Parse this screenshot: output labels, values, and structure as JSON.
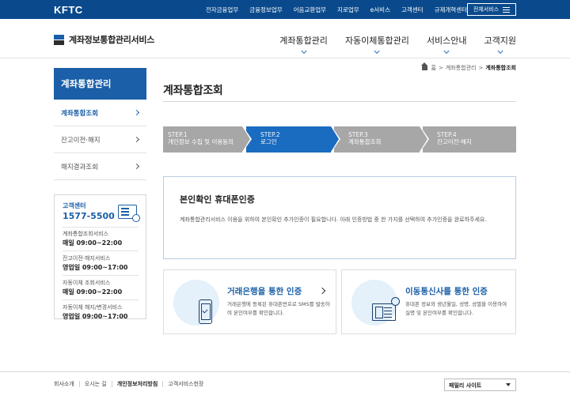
{
  "topbar": {
    "logo": "KFTC",
    "links": [
      "전자금융업무",
      "금융정보업무",
      "어음교환업무",
      "지로업무",
      "e서비스",
      "고객센터",
      "규제개혁센터"
    ],
    "all_services": "전체서비스"
  },
  "header": {
    "brand": "계좌정보통합관리서비스",
    "nav": [
      "계좌통합관리",
      "자동이체통합관리",
      "서비스안내",
      "고객지원"
    ]
  },
  "breadcrumb": {
    "items": [
      "홈",
      "계좌통합관리",
      "계좌통합조회"
    ]
  },
  "sidebar": {
    "title": "계좌통합관리",
    "items": [
      {
        "label": "계좌통합조회",
        "active": true
      },
      {
        "label": "잔고이전·해지",
        "active": false
      },
      {
        "label": "해지결과조회",
        "active": false
      }
    ]
  },
  "customer_center": {
    "label": "고객센터",
    "phone": "1577-5500",
    "rows": [
      {
        "name": "계좌통합조회서비스",
        "time": "매일 09:00~22:00"
      },
      {
        "name": "잔고이전·해지서비스",
        "time": "영업일 09:00~17:00"
      },
      {
        "name": "자동이체 조회서비스",
        "time": "매일 09:00~22:00"
      },
      {
        "name": "자동이체 해지/변경서비스",
        "time": "영업일 09:00~17:00"
      }
    ]
  },
  "main": {
    "title": "계좌통합조회",
    "steps": [
      {
        "step": "STEP.1",
        "label": "개인정보 수집 및 이용동의",
        "active": false
      },
      {
        "step": "STEP.2",
        "label": "로그인",
        "active": true
      },
      {
        "step": "STEP.3",
        "label": "계좌통합조회",
        "active": false
      },
      {
        "step": "STEP.4",
        "label": "잔고이전·해지",
        "active": false
      }
    ],
    "auth": {
      "title": "본인확인 휴대폰인증",
      "desc": "계좌통합관리서비스 이용을 위하여 본인확인 추가인증이 필요합니다. 아래 인증방법 중 한 가지를 선택하여 추가인증을 완료하주세요."
    },
    "cards": [
      {
        "title": "거래은행을 통한 인증",
        "desc": "거래은행에 등록된 휴대폰번호로 SMS를 발송하여 본인여부를 확인합니다."
      },
      {
        "title": "이동통신사를 통한 인증",
        "desc": "휴대폰 정보와 생년월일, 성명, 성별을 이용하여 실명 및 본인여부를 확인합니다."
      }
    ]
  },
  "footer": {
    "links": [
      "회사소개",
      "오시는 길",
      "개인정보처리방침",
      "고객서비스헌장"
    ],
    "family_site": "패밀리 사이트"
  }
}
